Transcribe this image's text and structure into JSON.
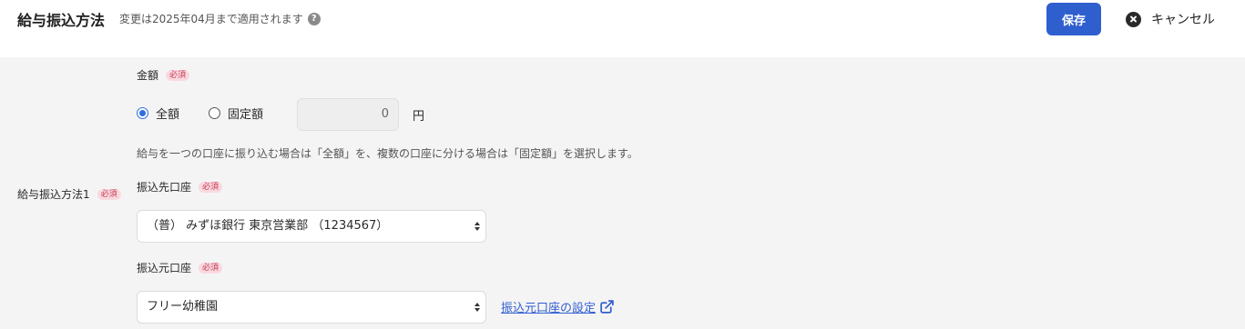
{
  "header": {
    "title": "給与振込方法",
    "subtitle": "変更は2025年04月まで適用されます",
    "help_icon_glyph": "?",
    "save_label": "保存",
    "cancel_label": "キャンセル"
  },
  "form": {
    "row_label": "給与振込方法1",
    "required_badge": "必須",
    "amount": {
      "label": "金額",
      "options": [
        {
          "label": "全額",
          "checked": true
        },
        {
          "label": "固定額",
          "checked": false
        }
      ],
      "fixed_amount_value": "0",
      "unit": "円",
      "help_text": "給与を一つの口座に振り込む場合は「全額」を、複数の口座に分ける場合は「固定額」を選択します。"
    },
    "destination_account": {
      "label": "振込先口座",
      "selected": "（普） みずほ銀行 東京営業部 （1234567）"
    },
    "source_account": {
      "label": "振込元口座",
      "selected": "フリー幼稚園",
      "settings_link": "振込元口座の設定"
    }
  },
  "colors": {
    "primary": "#2f5fcf",
    "badge_bg": "#f9d9df",
    "badge_text": "#c53a55",
    "content_bg": "#f5f4f5"
  },
  "icons": [
    "help-icon",
    "close-circle-icon",
    "external-link-icon",
    "select-arrows-icon"
  ]
}
